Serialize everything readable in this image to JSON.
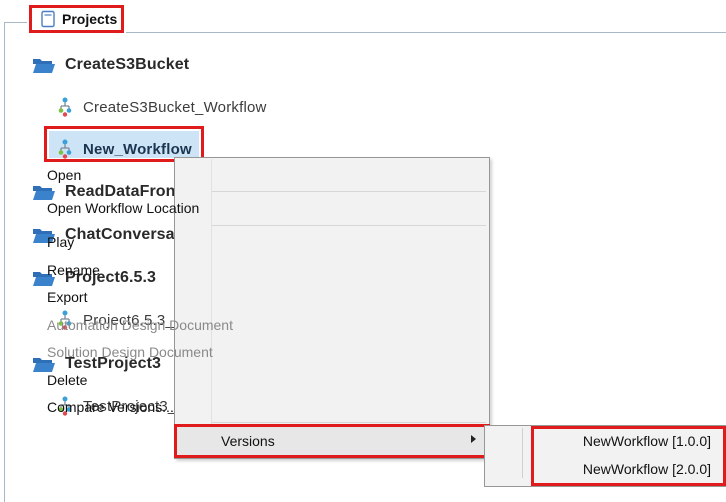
{
  "tab": {
    "label": "Projects"
  },
  "tree": {
    "project1": {
      "name": "CreateS3Bucket",
      "workflows": [
        "CreateS3Bucket_Workflow",
        "New_Workflow"
      ]
    },
    "project2": {
      "name": "ReadDataFron"
    },
    "project3": {
      "name": "ChatConversa"
    },
    "project4": {
      "name": "Project6.5.3",
      "workflow": "Project6.5.3_"
    },
    "project5": {
      "name": "TestProject3",
      "workflow": "TestProject3_"
    }
  },
  "context_menu": {
    "open": "Open",
    "open_location": "Open Workflow Location",
    "play": "Play",
    "rename": "Rename",
    "export": "Export",
    "automation_doc": "Automation Design Document",
    "solution_doc": "Solution Design Document",
    "delete": "Delete",
    "compare": "Compare Versions...",
    "versions": "Versions"
  },
  "versions_submenu": [
    "NewWorkflow [1.0.0]",
    "NewWorkflow [2.0.0]"
  ],
  "colors": {
    "highlight": "#e01b1b",
    "selection": "#cde3f6",
    "folder": "#2e6fb7"
  },
  "icons": {
    "tab": "projects-tab-icon",
    "folder": "folder-icon",
    "workflow": "workflow-icon",
    "submenu": "chevron-right-icon"
  }
}
